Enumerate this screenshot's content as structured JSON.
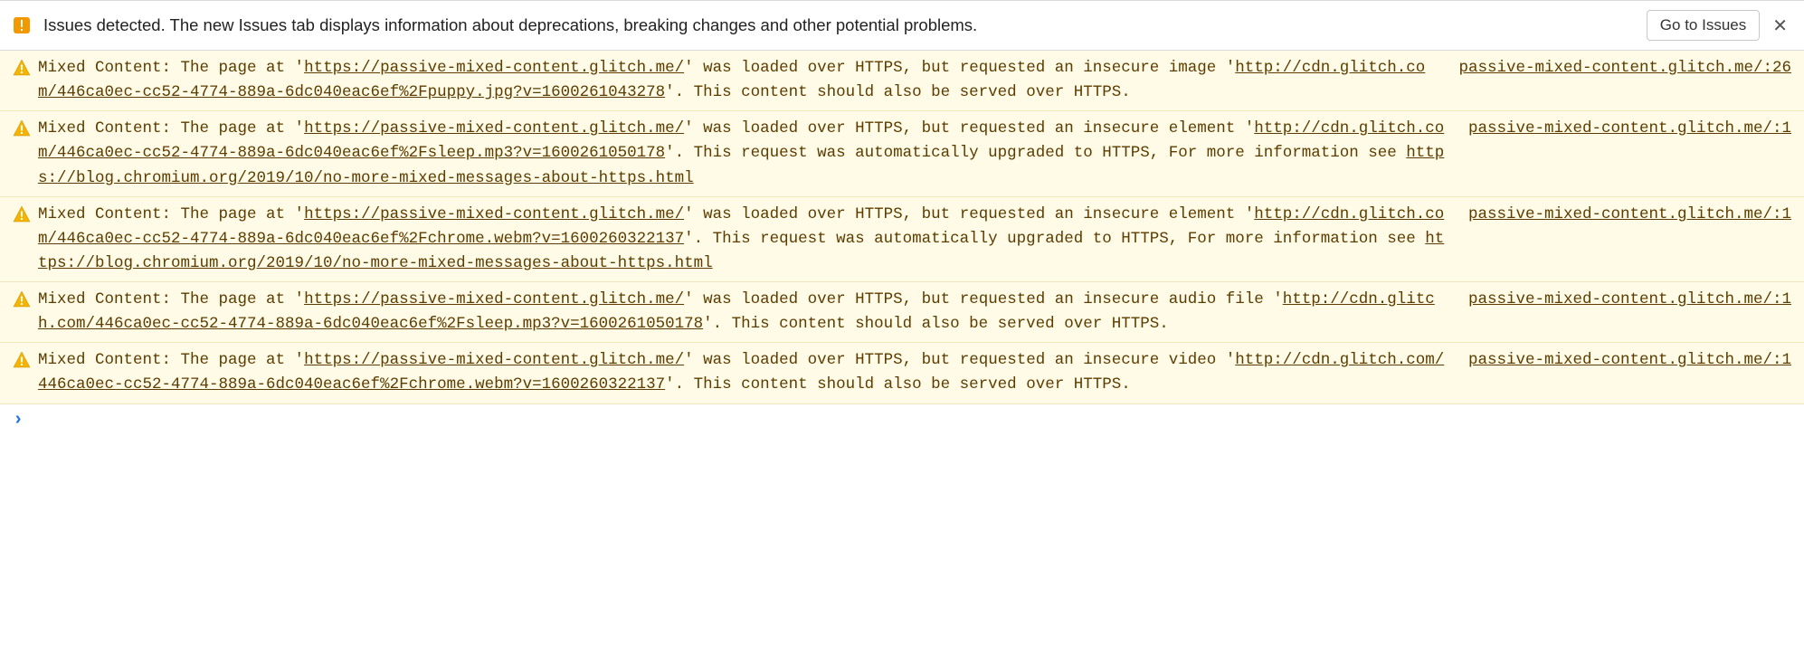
{
  "issues_bar": {
    "text": "Issues detected. The new Issues tab displays information about deprecations, breaking changes and other potential problems.",
    "button_label": "Go to Issues",
    "close_glyph": "✕"
  },
  "rows": [
    {
      "source_label": "passive-mixed-content.glitch.me/:26",
      "parts": [
        {
          "t": "Mixed Content: The page at '"
        },
        {
          "t": "https://passive-mixed-content.glitch.me/",
          "link": true
        },
        {
          "t": "' was loaded over HTTPS, but requested an insecure image '"
        },
        {
          "t": "http://cdn.glitch.com/446ca0ec-cc52-4774-889a-6dc040eac6ef%2Fpuppy.jpg?v=1600261043278",
          "link": true
        },
        {
          "t": "'. This content should also be served over HTTPS."
        }
      ]
    },
    {
      "source_label": "passive-mixed-content.glitch.me/:1",
      "parts": [
        {
          "t": "Mixed Content: The page at '"
        },
        {
          "t": "https://passive-mixed-content.glitch.me/",
          "link": true
        },
        {
          "t": "' was loaded over HTTPS, but requested an insecure element '"
        },
        {
          "t": "http://cdn.glitch.com/446ca0ec-cc52-4774-889a-6dc040eac6ef%2Fsleep.mp3?v=1600261050178",
          "link": true
        },
        {
          "t": "'. This request was automatically upgraded to HTTPS, For more information see "
        },
        {
          "t": "https://blog.chromium.org/2019/10/no-more-mixed-messages-about-https.html",
          "link": true
        }
      ]
    },
    {
      "source_label": "passive-mixed-content.glitch.me/:1",
      "parts": [
        {
          "t": "Mixed Content: The page at '"
        },
        {
          "t": "https://passive-mixed-content.glitch.me/",
          "link": true
        },
        {
          "t": "' was loaded over HTTPS, but requested an insecure element '"
        },
        {
          "t": "http://cdn.glitch.com/446ca0ec-cc52-4774-889a-6dc040eac6ef%2Fchrome.webm?v=1600260322137",
          "link": true
        },
        {
          "t": "'. This request was automatically upgraded to HTTPS, For more information see "
        },
        {
          "t": "https://blog.chromium.org/2019/10/no-more-mixed-messages-about-https.html",
          "link": true
        }
      ]
    },
    {
      "source_label": "passive-mixed-content.glitch.me/:1",
      "parts": [
        {
          "t": "Mixed Content: The page at '"
        },
        {
          "t": "https://passive-mixed-content.glitch.me/",
          "link": true
        },
        {
          "t": "' was loaded over HTTPS, but requested an insecure audio file '"
        },
        {
          "t": "http://cdn.glitch.com/446ca0ec-cc52-4774-889a-6dc040eac6ef%2Fsleep.mp3?v=1600261050178",
          "link": true
        },
        {
          "t": "'. This content should also be served over HTTPS."
        }
      ]
    },
    {
      "source_label": "passive-mixed-content.glitch.me/:1",
      "parts": [
        {
          "t": "Mixed Content: The page at '"
        },
        {
          "t": "https://passive-mixed-content.glitch.me/",
          "link": true
        },
        {
          "t": "' was loaded over HTTPS, but requested an insecure video '"
        },
        {
          "t": "http://cdn.glitch.com/446ca0ec-cc52-4774-889a-6dc040eac6ef%2Fchrome.webm?v=1600260322137",
          "link": true
        },
        {
          "t": "'. This content should also be served over HTTPS."
        }
      ]
    }
  ],
  "prompt": {
    "caret": "›"
  }
}
